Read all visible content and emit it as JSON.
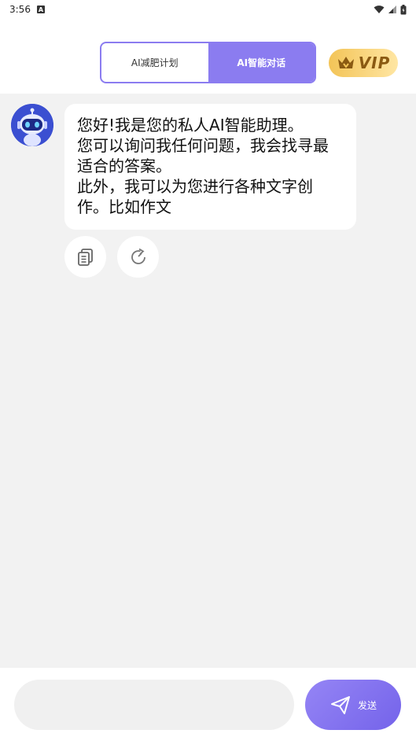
{
  "status_bar": {
    "time": "3:56",
    "notif_glyph": "A"
  },
  "header": {
    "tabs": [
      {
        "label": "AI减肥计划",
        "active": false
      },
      {
        "label": "AI智能对话",
        "active": true
      }
    ],
    "vip_label": "VIP"
  },
  "chat": {
    "messages": [
      {
        "sender": "assistant",
        "text": "您好!我是您的私人AI智能助理。\n 您可以询问我任何问题，我会找寻最适合的答案。\n 此外，我可以为您进行各种文字创作。比如作文"
      }
    ]
  },
  "composer": {
    "input_value": "",
    "placeholder": "",
    "send_label": "发送"
  },
  "colors": {
    "accent": "#8b7cf0",
    "chat_bg": "#f2f2f2",
    "vip_gold": "#f3c457",
    "avatar_bg": "#3b4fd1"
  }
}
